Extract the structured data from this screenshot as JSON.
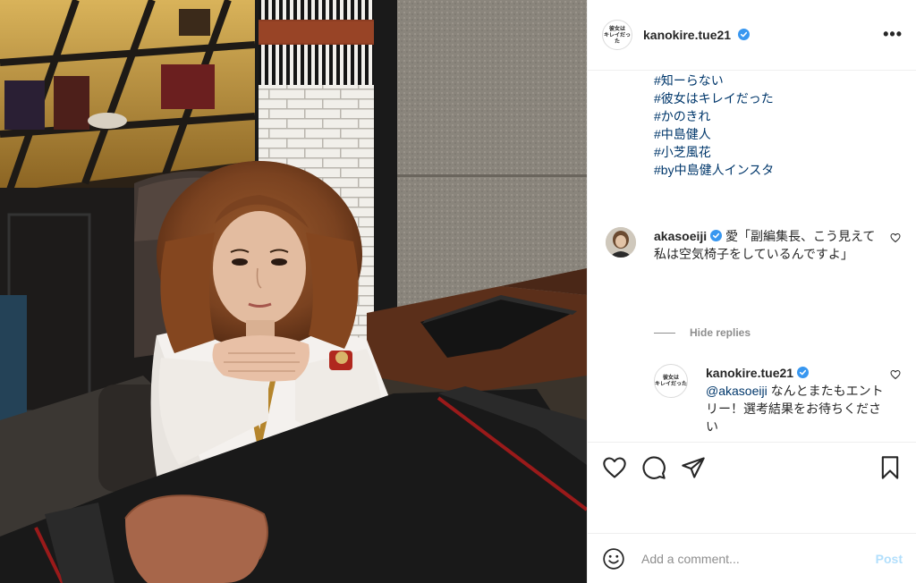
{
  "post": {
    "username": "kanokire.tue21",
    "verified": true,
    "avatar_text": [
      "彼女は",
      "キレイだった"
    ],
    "more_icon": "more-horizontal-icon"
  },
  "caption": {
    "hashtags": [
      "#知ーらない",
      "#彼女はキレイだった",
      "#かのきれ",
      "#中島健人",
      "#小芝風花",
      "#by中島健人インスタ"
    ]
  },
  "comments": [
    {
      "username": "akasoeiji",
      "verified": true,
      "text": "愛「副編集長、こう見えて私は空気椅子をしているんですよ」"
    }
  ],
  "hide_replies_label": "Hide replies",
  "replies": [
    {
      "username": "kanokire.tue21",
      "verified": true,
      "mention": "@akasoeiji",
      "text": " なんとまたもエントリー！選考結果をお待ちください"
    }
  ],
  "actions": {
    "icons": [
      "heart-icon",
      "comment-icon",
      "share-icon",
      "bookmark-icon"
    ]
  },
  "add_comment": {
    "placeholder": "Add a comment...",
    "post_label": "Post"
  },
  "colors": {
    "link": "#00376b",
    "verified": "#3897f0",
    "muted": "#8e8e8e",
    "post_disabled": "#b2dffc",
    "border": "#efefef"
  }
}
